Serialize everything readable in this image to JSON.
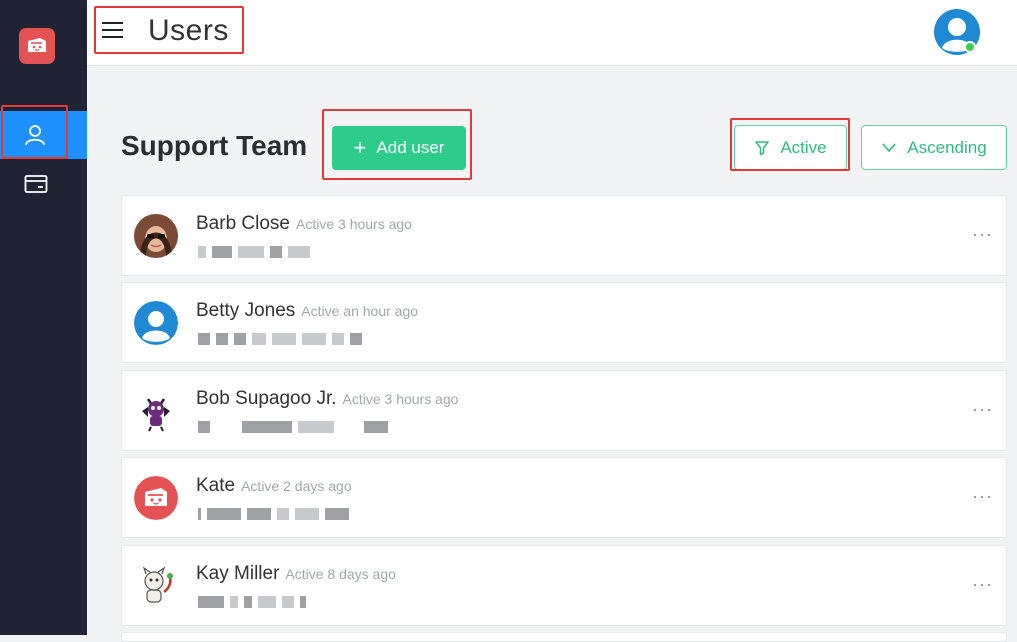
{
  "header": {
    "title": "Users"
  },
  "team": {
    "title": "Support Team"
  },
  "actions": {
    "add_user": "Add user",
    "filter": "Active",
    "sort": "Ascending"
  },
  "colors": {
    "sidebar": "#1f2333",
    "accent": "#1e90ff",
    "green": "#2ecc8a",
    "logo": "#e45353"
  },
  "users": [
    {
      "name": "Barb Close",
      "status": "Active 3 hours ago",
      "avatar": "photo",
      "menu": "···"
    },
    {
      "name": "Betty Jones",
      "status": "Active an hour ago",
      "avatar": "default-user-icon",
      "menu": ""
    },
    {
      "name": "Bob Supagoo Jr.",
      "status": "Active 3 hours ago",
      "avatar": "cartoon",
      "menu": "···"
    },
    {
      "name": "Kate",
      "status": "Active 2 days ago",
      "avatar": "logo-icon",
      "menu": "···"
    },
    {
      "name": "Kay Miller",
      "status": "Active 8 days ago",
      "avatar": "cartoon",
      "menu": "···"
    }
  ]
}
